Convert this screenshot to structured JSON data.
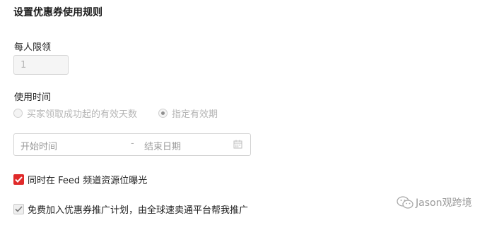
{
  "page": {
    "title": "设置优惠券使用规则"
  },
  "limit": {
    "label": "每人限领",
    "value": "1"
  },
  "usage_time": {
    "label": "使用时间",
    "options": [
      {
        "label": "买家领取成功起的有效天数",
        "selected": false,
        "disabled": true
      },
      {
        "label": "指定有效期",
        "selected": true,
        "disabled": true
      }
    ]
  },
  "date_range": {
    "start_placeholder": "开始时间",
    "separator": "-",
    "end_placeholder": "结束日期",
    "icon": "calendar-icon"
  },
  "checkboxes": [
    {
      "label": "同时在 Feed 频道资源位曝光",
      "checked": true,
      "color": "#e02a2a"
    },
    {
      "label": "免费加入优惠券推广计划，由全球速卖通平台帮我推广",
      "checked": true,
      "color": "#efefef"
    }
  ],
  "watermark": {
    "text": "Jason观跨境",
    "icon": "wechat-icon"
  }
}
